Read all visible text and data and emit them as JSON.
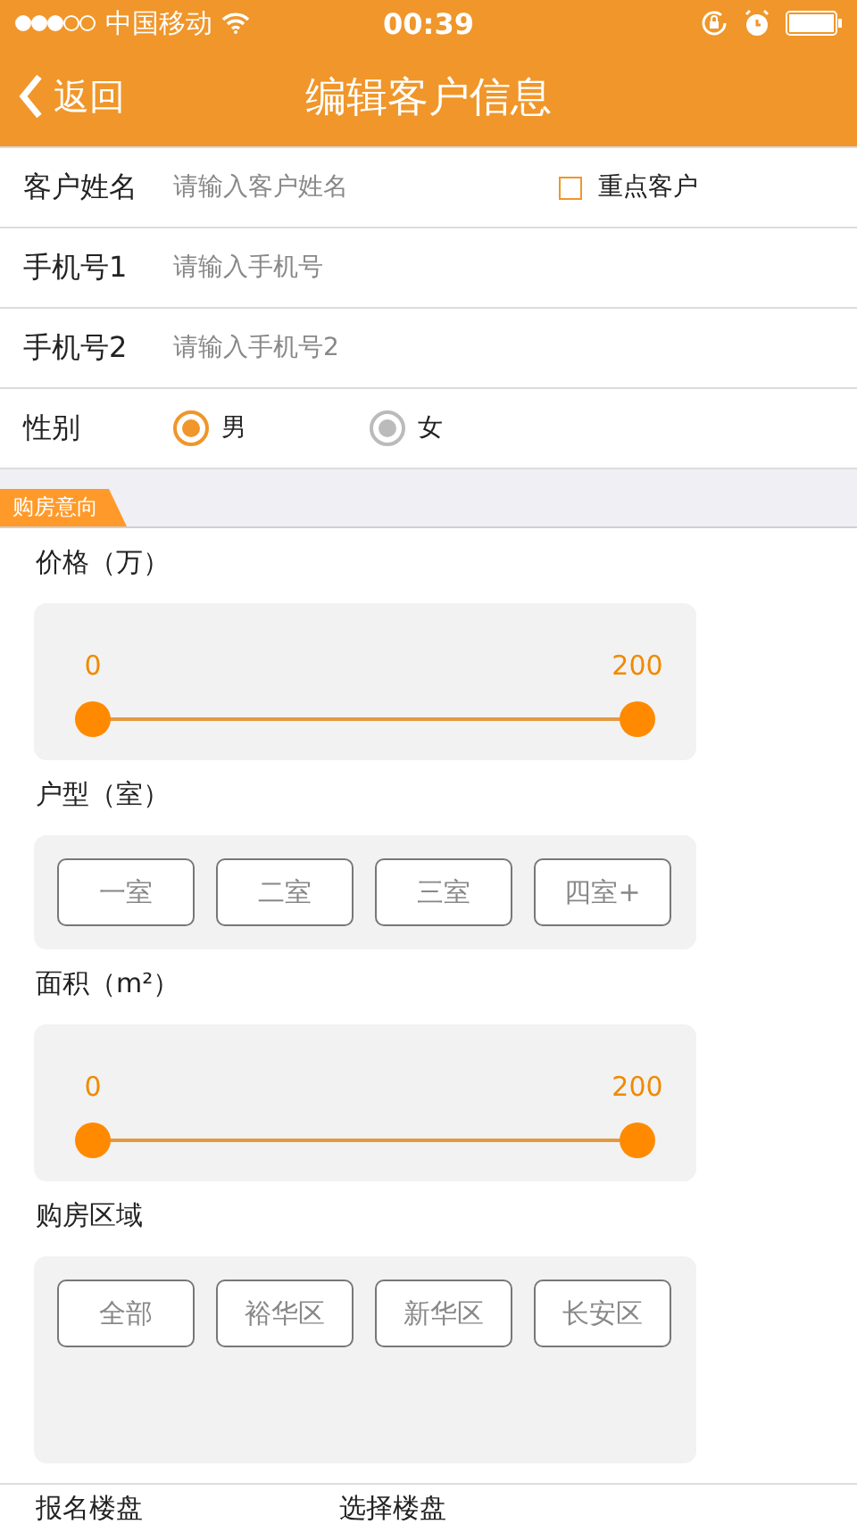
{
  "status_bar": {
    "carrier": "中国移动",
    "time": "00:39"
  },
  "nav": {
    "back": "返回",
    "title": "编辑客户信息"
  },
  "fields": [
    {
      "kind": "text",
      "label": "客户姓名",
      "placeholder": "请输入客户姓名",
      "checkbox": {
        "label": "重点客户",
        "checked": false
      }
    },
    {
      "kind": "text",
      "label": "手机号1",
      "placeholder": "请输入手机号"
    },
    {
      "kind": "text",
      "label": "手机号2",
      "placeholder": "请输入手机号2"
    },
    {
      "kind": "radio",
      "label": "性别",
      "options": [
        {
          "label": "男",
          "selected": true
        },
        {
          "label": "女",
          "selected": false
        }
      ]
    }
  ],
  "section_tab": "购房意向",
  "groups": [
    {
      "kind": "range",
      "title": "价格（万）",
      "thumbs": [
        {
          "label": "0",
          "level": 0
        },
        {
          "label": "200",
          "level": 1
        }
      ]
    },
    {
      "kind": "options",
      "title": "户型（室）",
      "options": [
        {
          "label": "一室",
          "selected": false
        },
        {
          "label": "二室",
          "selected": false
        },
        {
          "label": "三室",
          "selected": false
        },
        {
          "label": "四室+",
          "selected": false
        }
      ]
    },
    {
      "kind": "range",
      "title": "面积（m²）",
      "thumbs": [
        {
          "label": "0",
          "level": 0
        },
        {
          "label": "200",
          "level": 1
        }
      ]
    },
    {
      "kind": "options",
      "title": "购房区域",
      "options": [
        {
          "label": "全部",
          "selected": false
        },
        {
          "label": "裕华区",
          "selected": false
        },
        {
          "label": "新华区",
          "selected": false
        },
        {
          "label": "长安区",
          "selected": false
        }
      ]
    }
  ],
  "bottom_row": {
    "label": "报名楼盘",
    "value": "选择楼盘"
  }
}
